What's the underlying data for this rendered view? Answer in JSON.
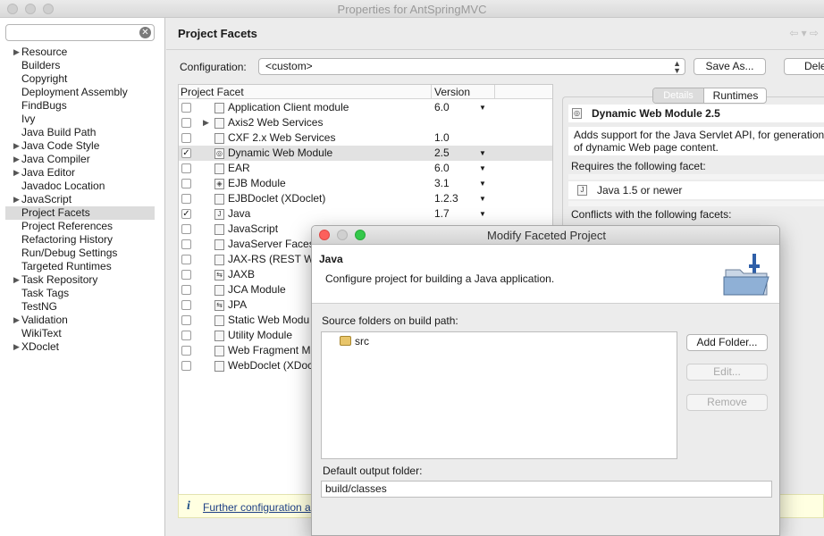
{
  "window": {
    "title": "Properties for AntSpringMVC"
  },
  "sidebar": {
    "filter_placeholder": "",
    "items": [
      {
        "label": "Resource",
        "expandable": true
      },
      {
        "label": "Builders",
        "expandable": false
      },
      {
        "label": "Copyright",
        "expandable": false
      },
      {
        "label": "Deployment Assembly",
        "expandable": false
      },
      {
        "label": "FindBugs",
        "expandable": false
      },
      {
        "label": "Ivy",
        "expandable": false
      },
      {
        "label": "Java Build Path",
        "expandable": false
      },
      {
        "label": "Java Code Style",
        "expandable": true
      },
      {
        "label": "Java Compiler",
        "expandable": true
      },
      {
        "label": "Java Editor",
        "expandable": true
      },
      {
        "label": "Javadoc Location",
        "expandable": false
      },
      {
        "label": "JavaScript",
        "expandable": true
      },
      {
        "label": "Project Facets",
        "expandable": false,
        "selected": true
      },
      {
        "label": "Project References",
        "expandable": false
      },
      {
        "label": "Refactoring History",
        "expandable": false
      },
      {
        "label": "Run/Debug Settings",
        "expandable": false
      },
      {
        "label": "Targeted Runtimes",
        "expandable": false
      },
      {
        "label": "Task Repository",
        "expandable": true
      },
      {
        "label": "Task Tags",
        "expandable": false
      },
      {
        "label": "TestNG",
        "expandable": false
      },
      {
        "label": "Validation",
        "expandable": true
      },
      {
        "label": "WikiText",
        "expandable": false
      },
      {
        "label": "XDoclet",
        "expandable": true
      }
    ]
  },
  "content": {
    "title": "Project Facets",
    "config_label": "Configuration:",
    "config_value": "<custom>",
    "save_as": "Save As...",
    "delete": "Dele",
    "col_facet": "Project Facet",
    "col_version": "Version",
    "facets": [
      {
        "label": "Application Client module",
        "version": "6.0",
        "checked": false,
        "dropdown": true
      },
      {
        "label": "Axis2 Web Services",
        "version": "",
        "checked": false,
        "dropdown": false,
        "expandable": true
      },
      {
        "label": "CXF 2.x Web Services",
        "version": "1.0",
        "checked": false,
        "dropdown": false
      },
      {
        "label": "Dynamic Web Module",
        "version": "2.5",
        "checked": true,
        "dropdown": true,
        "selected": true
      },
      {
        "label": "EAR",
        "version": "6.0",
        "checked": false,
        "dropdown": true
      },
      {
        "label": "EJB Module",
        "version": "3.1",
        "checked": false,
        "dropdown": true
      },
      {
        "label": "EJBDoclet (XDoclet)",
        "version": "1.2.3",
        "checked": false,
        "dropdown": true
      },
      {
        "label": "Java",
        "version": "1.7",
        "checked": true,
        "dropdown": true
      },
      {
        "label": "JavaScript",
        "version": "",
        "checked": false,
        "dropdown": false
      },
      {
        "label": "JavaServer Faces",
        "version": "",
        "checked": false,
        "dropdown": false
      },
      {
        "label": "JAX-RS (REST We",
        "version": "",
        "checked": false,
        "dropdown": false
      },
      {
        "label": "JAXB",
        "version": "",
        "checked": false,
        "dropdown": false
      },
      {
        "label": "JCA Module",
        "version": "",
        "checked": false,
        "dropdown": false
      },
      {
        "label": "JPA",
        "version": "",
        "checked": false,
        "dropdown": false
      },
      {
        "label": "Static Web Modu",
        "version": "",
        "checked": false,
        "dropdown": false
      },
      {
        "label": "Utility Module",
        "version": "",
        "checked": false,
        "dropdown": false
      },
      {
        "label": "Web Fragment Mo",
        "version": "",
        "checked": false,
        "dropdown": false
      },
      {
        "label": "WebDoclet (XDoc",
        "version": "",
        "checked": false,
        "dropdown": false
      }
    ],
    "tabs": {
      "details": "Details",
      "runtimes": "Runtimes"
    },
    "details": {
      "heading": "Dynamic Web Module 2.5",
      "desc_line1": "Adds support for the Java Servlet API, for generation",
      "desc_line2": "of dynamic Web page content.",
      "requires_label": "Requires the following facet:",
      "requires_value": "Java 1.5 or newer",
      "conflicts_label": "Conflicts with the following facets:"
    },
    "info_text": "Further configuration a"
  },
  "dialog": {
    "title": "Modify Faceted Project",
    "heading": "Java",
    "description": "Configure project for building a Java application.",
    "source_label": "Source folders on build path:",
    "source_items": [
      "src"
    ],
    "add_folder": "Add Folder...",
    "edit": "Edit...",
    "remove": "Remove",
    "output_label": "Default output folder:",
    "output_value": "build/classes"
  },
  "colors": {
    "selection": "#dcdcdc",
    "info_bg": "#ffffe1",
    "close": "#fc605c",
    "minimize": "#d0d0d0",
    "zoom": "#34c84a"
  }
}
